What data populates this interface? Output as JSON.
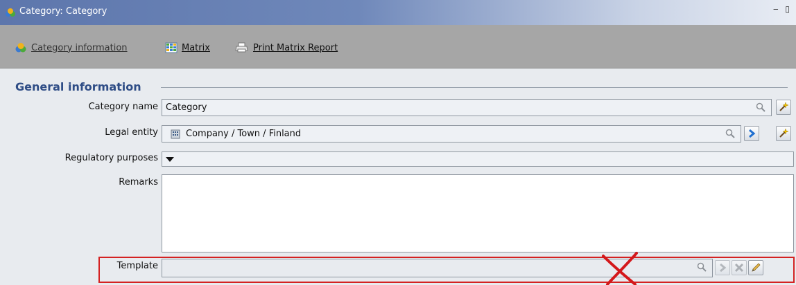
{
  "window": {
    "title": "Category: Category",
    "controls": "‒ ▯"
  },
  "toolbar": {
    "category_info_label": "Category information",
    "matrix_label": "Matrix",
    "print_label": "Print Matrix Report"
  },
  "section": {
    "title": "General information"
  },
  "form": {
    "category_name_label": "Category name",
    "category_name_value": "Category",
    "legal_entity_label": "Legal entity",
    "legal_entity_value": "Company / Town / Finland",
    "regulatory_label": "Regulatory purposes",
    "remarks_label": "Remarks",
    "remarks_value": "",
    "template_label": "Template",
    "template_value": ""
  },
  "icons": {
    "app": "category-icon",
    "matrix": "matrix-icon",
    "print": "printer-icon",
    "search": "magnifier-icon",
    "wand": "magic-wand-icon",
    "navigate": "arrow-right-icon",
    "clear": "clear-x-icon",
    "edit": "pencil-icon",
    "building": "building-icon",
    "dropdown": "dropdown-arrow-icon",
    "annotation": "red-x-mark-icon"
  },
  "colors": {
    "titlebar": "#5d76ac",
    "toolbar": "#a6a6a6",
    "section_title": "#2f4d86",
    "highlight_border": "#d42222"
  }
}
